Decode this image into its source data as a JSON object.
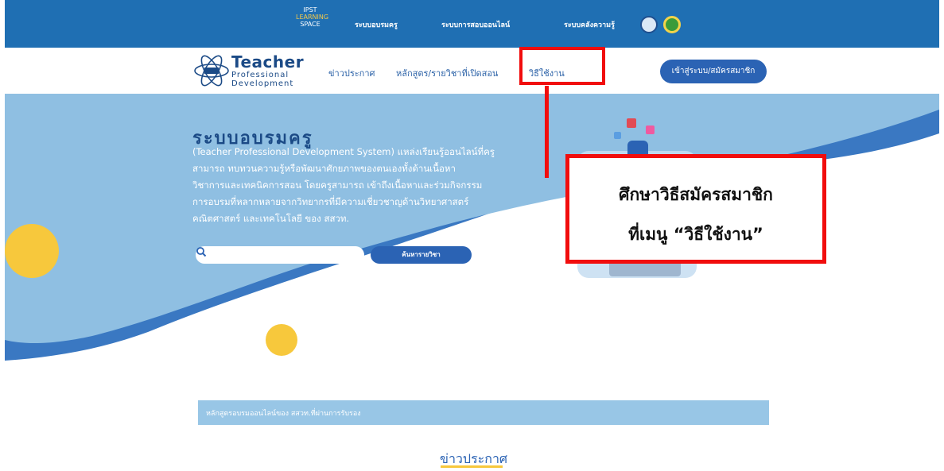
{
  "colors": {
    "topbar_bg": "#1f6fb3",
    "hero_light": "#8fbfe2",
    "hero_dark": "#3a78c2",
    "primary_button": "#2b63b4",
    "accent_yellow": "#f7c83c",
    "annotation_red": "#f10d0d"
  },
  "topbar": {
    "logo_line1": "IPST",
    "logo_line2": "LEARNING",
    "logo_line3": "SPACE",
    "links": [
      "ระบบอบรมครู",
      "ระบบการสอบออนไลน์",
      "ระบบคลังความรู้"
    ]
  },
  "nav": {
    "brand_line1": "Teacher",
    "brand_line2": "Professional",
    "brand_line3": "Development",
    "items": [
      "ข่าวประกาศ",
      "หลักสูตร/รายวิชาที่เปิดสอน",
      "วิธีใช้งาน"
    ],
    "login_label": "เข้าสู่ระบบ/สมัครสมาชิก"
  },
  "hero": {
    "title": "ระบบอบรมครู",
    "lines": [
      "(Teacher Professional Development System) แหล่งเรียนรู้ออนไลน์ที่ครู",
      "สามารถ ทบทวนความรู้หรือพัฒนาศักยภาพของตนเองทั้งด้านเนื้อหา",
      "วิชาการและเทคนิคการสอน โดยครูสามารถ เข้าถึงเนื้อหาและร่วมกิจกรรม",
      "การอบรมที่หลากหลายจากวิทยากรที่มีความเชี่ยวชาญด้านวิทยาศาสตร์",
      "คณิตศาสตร์ และเทคโนโลยี ของ สสวท."
    ],
    "search_placeholder": "",
    "search_button": "ค้นหารายวิชา"
  },
  "annotation": {
    "line1": "ศึกษาวิธีสมัครสมาชิก",
    "line2": "ที่เมนู “วิธีใช้งาน”"
  },
  "certified_bar": "หลักสูตรอบรมออนไลน์ของ สสวท.ที่ผ่านการรับรอง",
  "news_heading": "ข่าวประกาศ"
}
